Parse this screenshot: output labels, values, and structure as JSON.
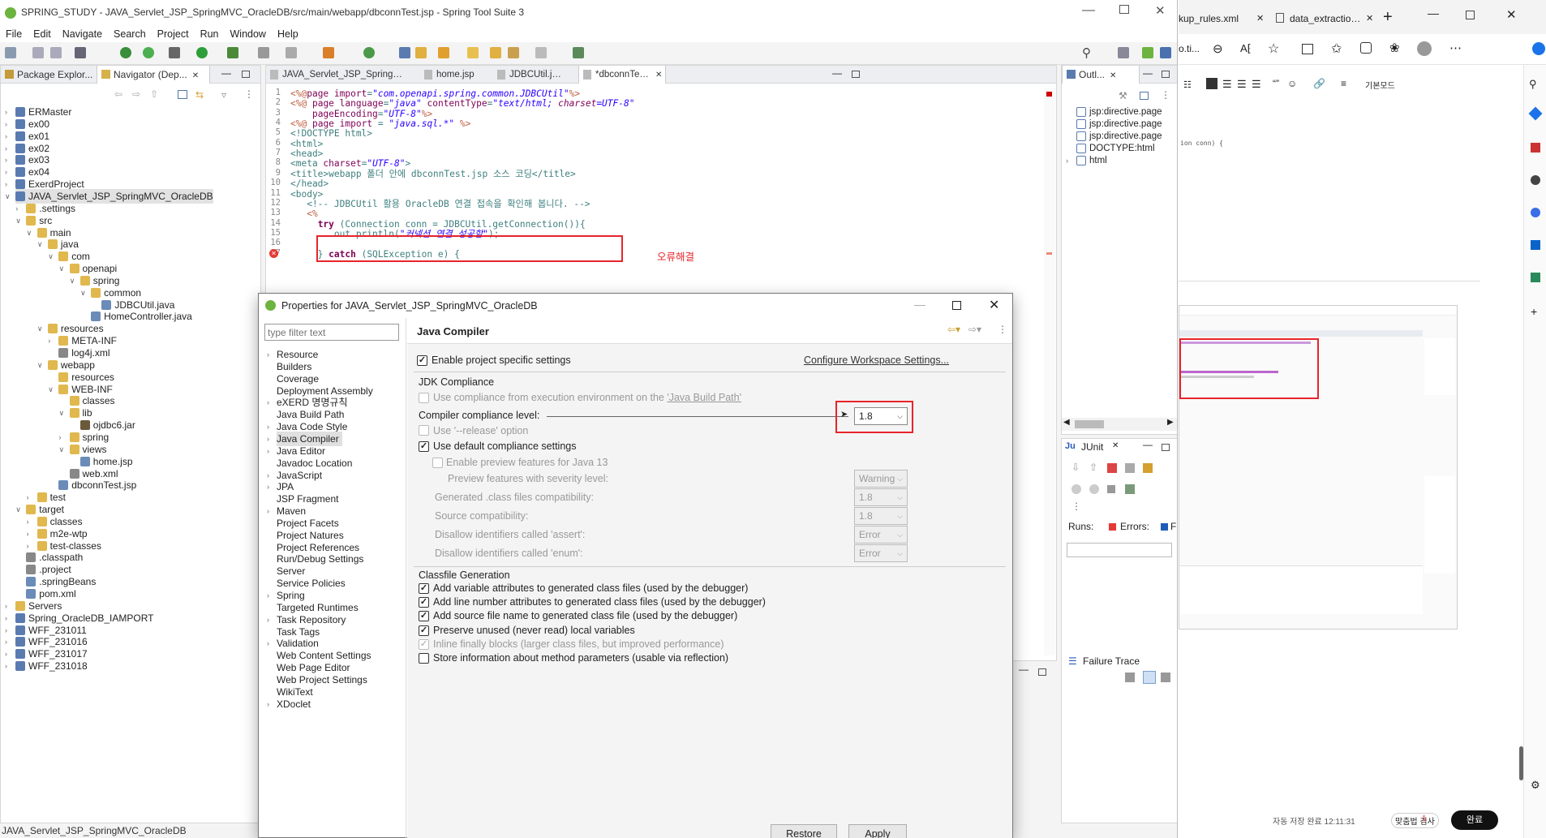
{
  "window": {
    "title": "SPRING_STUDY - JAVA_Servlet_JSP_SpringMVC_OracleDB/src/main/webapp/dbconnTest.jsp - Spring Tool Suite 3"
  },
  "menu": [
    "File",
    "Edit",
    "Navigate",
    "Search",
    "Project",
    "Run",
    "Window",
    "Help"
  ],
  "left_tabs": {
    "package": "Package Explor...",
    "navigator": "Navigator (Dep..."
  },
  "tree": [
    {
      "label": "ERMaster",
      "indent": 0,
      "icon": "project-icon"
    },
    {
      "label": "ex00",
      "indent": 0,
      "icon": "project-icon"
    },
    {
      "label": "ex01",
      "indent": 0,
      "icon": "project-icon"
    },
    {
      "label": "ex02",
      "indent": 0,
      "icon": "project-icon"
    },
    {
      "label": "ex03",
      "indent": 0,
      "icon": "project-icon"
    },
    {
      "label": "ex04",
      "indent": 0,
      "icon": "project-icon"
    },
    {
      "label": "ExerdProject",
      "indent": 0,
      "icon": "project-icon"
    },
    {
      "label": "JAVA_Servlet_JSP_SpringMVC_OracleDB",
      "indent": 0,
      "icon": "project-icon",
      "open": true,
      "selected": true
    },
    {
      "label": ".settings",
      "indent": 1,
      "icon": "folder-icon"
    },
    {
      "label": "src",
      "indent": 1,
      "icon": "folder-icon",
      "open": true
    },
    {
      "label": "main",
      "indent": 2,
      "icon": "folder-icon",
      "open": true
    },
    {
      "label": "java",
      "indent": 3,
      "icon": "folder-icon",
      "open": true
    },
    {
      "label": "com",
      "indent": 4,
      "icon": "folder-icon",
      "open": true
    },
    {
      "label": "openapi",
      "indent": 5,
      "icon": "folder-icon",
      "open": true
    },
    {
      "label": "spring",
      "indent": 6,
      "icon": "folder-icon",
      "open": true
    },
    {
      "label": "common",
      "indent": 7,
      "icon": "folder-icon",
      "open": true
    },
    {
      "label": "JDBCUtil.java",
      "indent": 8,
      "icon": "file-icon",
      "leaf": true
    },
    {
      "label": "HomeController.java",
      "indent": 7,
      "icon": "file-icon",
      "leaf": true
    },
    {
      "label": "resources",
      "indent": 3,
      "icon": "folder-icon",
      "open": true
    },
    {
      "label": "META-INF",
      "indent": 4,
      "icon": "folder-icon"
    },
    {
      "label": "log4j.xml",
      "indent": 4,
      "icon": "xml-file-icon",
      "leaf": true
    },
    {
      "label": "webapp",
      "indent": 3,
      "icon": "folder-icon",
      "open": true
    },
    {
      "label": "resources",
      "indent": 4,
      "icon": "folder-icon",
      "leaf": true
    },
    {
      "label": "WEB-INF",
      "indent": 4,
      "icon": "folder-icon",
      "open": true
    },
    {
      "label": "classes",
      "indent": 5,
      "icon": "folder-icon",
      "leaf": true
    },
    {
      "label": "lib",
      "indent": 5,
      "icon": "folder-icon",
      "open": true
    },
    {
      "label": "ojdbc6.jar",
      "indent": 6,
      "icon": "jar-icon",
      "leaf": true
    },
    {
      "label": "spring",
      "indent": 5,
      "icon": "folder-icon"
    },
    {
      "label": "views",
      "indent": 5,
      "icon": "folder-icon",
      "open": true
    },
    {
      "label": "home.jsp",
      "indent": 6,
      "icon": "file-icon",
      "leaf": true
    },
    {
      "label": "web.xml",
      "indent": 5,
      "icon": "xml-file-icon",
      "leaf": true
    },
    {
      "label": "dbconnTest.jsp",
      "indent": 4,
      "icon": "file-icon",
      "leaf": true
    },
    {
      "label": "test",
      "indent": 2,
      "icon": "folder-icon"
    },
    {
      "label": "target",
      "indent": 1,
      "icon": "folder-icon",
      "open": true
    },
    {
      "label": "classes",
      "indent": 2,
      "icon": "folder-icon"
    },
    {
      "label": "m2e-wtp",
      "indent": 2,
      "icon": "folder-icon"
    },
    {
      "label": "test-classes",
      "indent": 2,
      "icon": "folder-icon"
    },
    {
      "label": ".classpath",
      "indent": 1,
      "icon": "xml-file-icon",
      "leaf": true
    },
    {
      "label": ".project",
      "indent": 1,
      "icon": "xml-file-icon",
      "leaf": true
    },
    {
      "label": ".springBeans",
      "indent": 1,
      "icon": "file-icon",
      "leaf": true
    },
    {
      "label": "pom.xml",
      "indent": 1,
      "icon": "file-icon",
      "leaf": true
    },
    {
      "label": "Servers",
      "indent": 0,
      "icon": "folder-icon"
    },
    {
      "label": "Spring_OracleDB_IAMPORT",
      "indent": 0,
      "icon": "project-icon"
    },
    {
      "label": "WFF_231011",
      "indent": 0,
      "icon": "project-icon"
    },
    {
      "label": "WFF_231016",
      "indent": 0,
      "icon": "project-icon"
    },
    {
      "label": "WFF_231017",
      "indent": 0,
      "icon": "project-icon"
    },
    {
      "label": "WFF_231018",
      "indent": 0,
      "icon": "project-icon"
    }
  ],
  "status_bar": "JAVA_Servlet_JSP_SpringMVC_OracleDB",
  "editor_tabs": [
    "JAVA_Servlet_JSP_SpringMVC_OracleDB/pom.xml",
    "home.jsp",
    "JDBCUtil.java",
    "*dbconnTest.jsp"
  ],
  "code": [
    {
      "n": "1",
      "t": "<%@page import=\"com.openapi.spring.common.JDBCUtil\"%>"
    },
    {
      "n": "2",
      "t": "<%@ page language=\"java\" contentType=\"text/html; charset=UTF-8\""
    },
    {
      "n": "3",
      "t": "    pageEncoding=\"UTF-8\"%>"
    },
    {
      "n": "4",
      "t": "<%@ page import = \"java.sql.*\" %>"
    },
    {
      "n": "5",
      "t": "<!DOCTYPE html>"
    },
    {
      "n": "6",
      "t": "<html>"
    },
    {
      "n": "7",
      "t": "<head>"
    },
    {
      "n": "8",
      "t": "<meta charset=\"UTF-8\">"
    },
    {
      "n": "9",
      "t": "<title>webapp 폴더 안에 dbconnTest.jsp 소스 코딩</title>"
    },
    {
      "n": "10",
      "t": "</head>"
    },
    {
      "n": "11",
      "t": "<body>"
    },
    {
      "n": "12",
      "t": "   <!-- JDBCUtil 활용 OracleDB 연결 접속을 확인해 봅니다. -->"
    },
    {
      "n": "13",
      "t": "   <%"
    },
    {
      "n": "14",
      "t": "     try (Connection conn = JDBCUtil.getConnection()){"
    },
    {
      "n": "15",
      "t": "        out.println(\"커넥션 연결 성공함\");"
    },
    {
      "n": "16",
      "t": ""
    },
    {
      "n": "17",
      "t": "     } catch (SQLException e) {"
    }
  ],
  "annotation": "오류해결",
  "outline": {
    "tab": "Outl...",
    "items": [
      "jsp:directive.page",
      "jsp:directive.page",
      "jsp:directive.page",
      "DOCTYPE:html",
      "html"
    ]
  },
  "junit": {
    "tab": "JUnit",
    "runs": "Runs:",
    "errors": "Errors:",
    "failures": "Fa",
    "failure_trace": "Failure Trace"
  },
  "dialog": {
    "title": "Properties for JAVA_Servlet_JSP_SpringMVC_OracleDB",
    "filter_placeholder": "type filter text",
    "categories": [
      {
        "label": "Resource",
        "exp": true
      },
      {
        "label": "Builders"
      },
      {
        "label": "Coverage"
      },
      {
        "label": "Deployment Assembly"
      },
      {
        "label": "eXERD 명명규칙",
        "exp": true
      },
      {
        "label": "Java Build Path"
      },
      {
        "label": "Java Code Style",
        "exp": true
      },
      {
        "label": "Java Compiler",
        "exp": true,
        "selected": true
      },
      {
        "label": "Java Editor",
        "exp": true
      },
      {
        "label": "Javadoc Location"
      },
      {
        "label": "JavaScript",
        "exp": true
      },
      {
        "label": "JPA",
        "exp": true
      },
      {
        "label": "JSP Fragment"
      },
      {
        "label": "Maven",
        "exp": true
      },
      {
        "label": "Project Facets"
      },
      {
        "label": "Project Natures"
      },
      {
        "label": "Project References"
      },
      {
        "label": "Run/Debug Settings"
      },
      {
        "label": "Server"
      },
      {
        "label": "Service Policies"
      },
      {
        "label": "Spring",
        "exp": true
      },
      {
        "label": "Targeted Runtimes"
      },
      {
        "label": "Task Repository",
        "exp": true
      },
      {
        "label": "Task Tags"
      },
      {
        "label": "Validation",
        "exp": true
      },
      {
        "label": "Web Content Settings"
      },
      {
        "label": "Web Page Editor"
      },
      {
        "label": "Web Project Settings"
      },
      {
        "label": "WikiText"
      },
      {
        "label": "XDoclet",
        "exp": true
      }
    ],
    "page_title": "Java Compiler",
    "enable_specific": "Enable project specific settings",
    "configure_link": "Configure Workspace Settings...",
    "jdk_group": "JDK Compliance",
    "use_env": "Use compliance from execution environment on the ",
    "use_env_link": "'Java Build Path'",
    "level_label": "Compiler compliance level:",
    "level_value": "1.8",
    "release_option": "Use '--release' option",
    "default_compliance": "Use default compliance settings",
    "preview_enable": "Enable preview features for Java 13",
    "preview_severity": "Preview features with severity level:",
    "preview_severity_value": "Warning",
    "generated_compat": "Generated .class files compatibility:",
    "generated_compat_value": "1.8",
    "source_compat": "Source compatibility:",
    "source_compat_value": "1.8",
    "disallow_assert": "Disallow identifiers called 'assert':",
    "disallow_assert_value": "Error",
    "disallow_enum": "Disallow identifiers called 'enum':",
    "disallow_enum_value": "Error",
    "classfile_group": "Classfile Generation",
    "classfile": [
      {
        "label": "Add variable attributes to generated class files (used by the debugger)",
        "checked": true
      },
      {
        "label": "Add line number attributes to generated class files (used by the debugger)",
        "checked": true
      },
      {
        "label": "Add source file name to generated class file (used by the debugger)",
        "checked": true
      },
      {
        "label": "Preserve unused (never read) local variables",
        "checked": true
      },
      {
        "label": "Inline finally blocks (larger class files, but improved performance)",
        "checked": true,
        "disabled": true
      },
      {
        "label": "Store information about method parameters (usable via reflection)",
        "checked": false
      }
    ],
    "restore_defaults": "Restore Defaults",
    "apply": "Apply"
  },
  "browser": {
    "tabs": [
      "kup_rules.xml",
      "data_extraction_r"
    ],
    "addr": "o.ti...",
    "mode": "기본모드",
    "code_frag": "ion conn) {",
    "bottom_text": "자동 저장 완료 12:11:31",
    "spell": "맞춤법 검사",
    "badge": "1",
    "done": "완료"
  },
  "colors": {
    "accent": "#0b62c4",
    "highlight": "#e8242b",
    "keyword": "#7f0055",
    "string": "#2a00ff",
    "tag": "#3f7f7f",
    "comment": "#3f5fbf"
  }
}
